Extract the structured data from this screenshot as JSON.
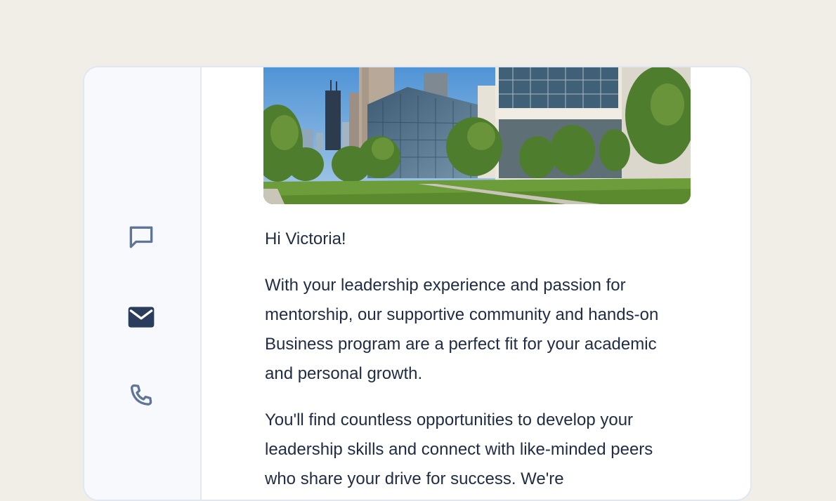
{
  "sidebar": {
    "icons": [
      {
        "name": "chat-icon"
      },
      {
        "name": "mail-icon"
      },
      {
        "name": "phone-icon"
      }
    ]
  },
  "message": {
    "greeting": "Hi Victoria!",
    "paragraph1": "With your leadership experience and passion for mentorship, our supportive community and hands-on Business program are a perfect fit for your academic and personal growth.",
    "paragraph2": "You'll find countless opportunities to develop your leadership skills and connect with like-minded peers who share your drive for success. We're"
  },
  "colors": {
    "page_bg": "#f1eee8",
    "text": "#1f2c44",
    "icon_muted": "#5f7595",
    "icon_active": "#2b3d5c"
  }
}
